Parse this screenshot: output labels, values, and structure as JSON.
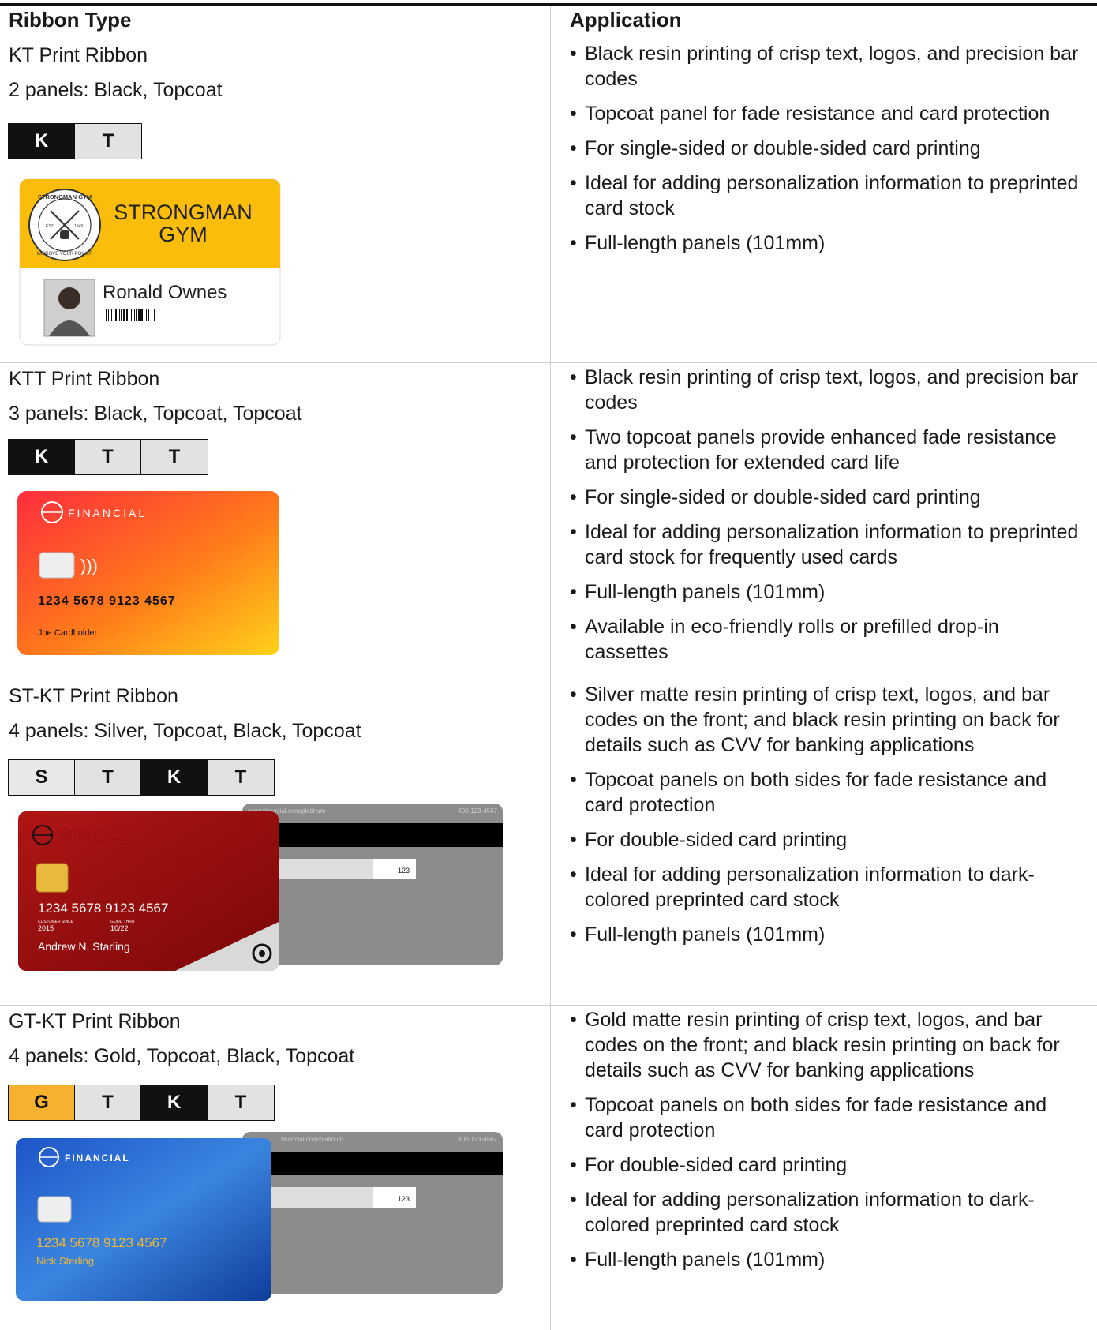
{
  "header": {
    "col1": "Ribbon Type",
    "col2": "Application"
  },
  "colors": {
    "black": "#111111",
    "topcoat": "#e2e2e2",
    "silver": "#e8e8e8",
    "gold": "#f6b12e"
  },
  "rows": [
    {
      "name": "KT Print Ribbon",
      "panels_text": "2 panels: Black, Topcoat",
      "panels": [
        "K",
        "T"
      ],
      "card": {
        "gym_line1": "STRONGMAN",
        "gym_line2": "GYM",
        "badge_top": "STRONGMAN GYM",
        "badge_bottom": "IMPROVE YOUR POWER",
        "badge_est": "EST",
        "badge_year": "1949",
        "holder": "Ronald Ownes"
      },
      "bullets": [
        "Black resin printing of crisp text, logos, and precision bar codes",
        "Topcoat panel for fade resistance and card protection",
        "For single-sided or double-sided card printing",
        "Ideal for adding personalization information to preprinted card stock",
        "Full-length panels (101mm)"
      ]
    },
    {
      "name": "KTT Print Ribbon",
      "panels_text": "3 panels: Black, Topcoat, Topcoat",
      "panels": [
        "K",
        "T",
        "T"
      ],
      "card": {
        "brand": "FINANCIAL",
        "number": "1234 5678 9123 4567",
        "holder": "Joe Cardholder"
      },
      "bullets": [
        "Black resin printing of crisp text, logos, and precision bar codes",
        "Two topcoat panels provide enhanced fade resistance and protection for extended card life",
        "For single-sided or double-sided card printing",
        "Ideal for adding personalization information to preprinted card stock for frequently used cards",
        "Full-length panels (101mm)",
        "Available in eco-friendly rolls or prefilled drop-in cassettes"
      ]
    },
    {
      "name": "ST-KT Print Ribbon",
      "panels_text": "4 panels: Silver, Topcoat, Black, Topcoat",
      "panels": [
        "S",
        "T",
        "K",
        "T"
      ],
      "card": {
        "brand": "FINANCIAL",
        "number": "1234 5678 9123 4567",
        "since_label": "CUSTOMER SINCE",
        "since": "2015",
        "thru_label": "GOOD THRU",
        "thru": "10/22",
        "holder": "Andrew N. Starling",
        "back_url": "www.financial.com/platinum",
        "back_phone": "800-123-4567",
        "cvv": "123"
      },
      "bullets": [
        "Silver matte resin printing of crisp text, logos, and bar codes on the front; and black resin printing on back for details such as CVV for banking applications",
        "Topcoat panels on both sides for fade resistance and card protection",
        "For double-sided card printing",
        "Ideal for adding personalization information to dark-colored preprinted card stock",
        "Full-length panels (101mm)"
      ]
    },
    {
      "name": "GT-KT Print Ribbon",
      "panels_text": "4 panels: Gold, Topcoat, Black, Topcoat",
      "panels": [
        "G",
        "T",
        "K",
        "T"
      ],
      "card": {
        "brand": "FINANCIAL",
        "number": "1234 5678 9123 4567",
        "holder": "Nick Sterling",
        "back_url": "financial.com/platinum",
        "back_phone": "800-123-4567",
        "cvv": "123"
      },
      "bullets": [
        "Gold matte resin printing of crisp text, logos, and bar codes on the front; and black resin printing on back for details such as CVV for banking applications",
        "Topcoat panels on both sides for fade resistance and card protection",
        "For double-sided card printing",
        "Ideal for adding personalization information to dark-colored preprinted card stock",
        "Full-length panels (101mm)"
      ]
    }
  ]
}
